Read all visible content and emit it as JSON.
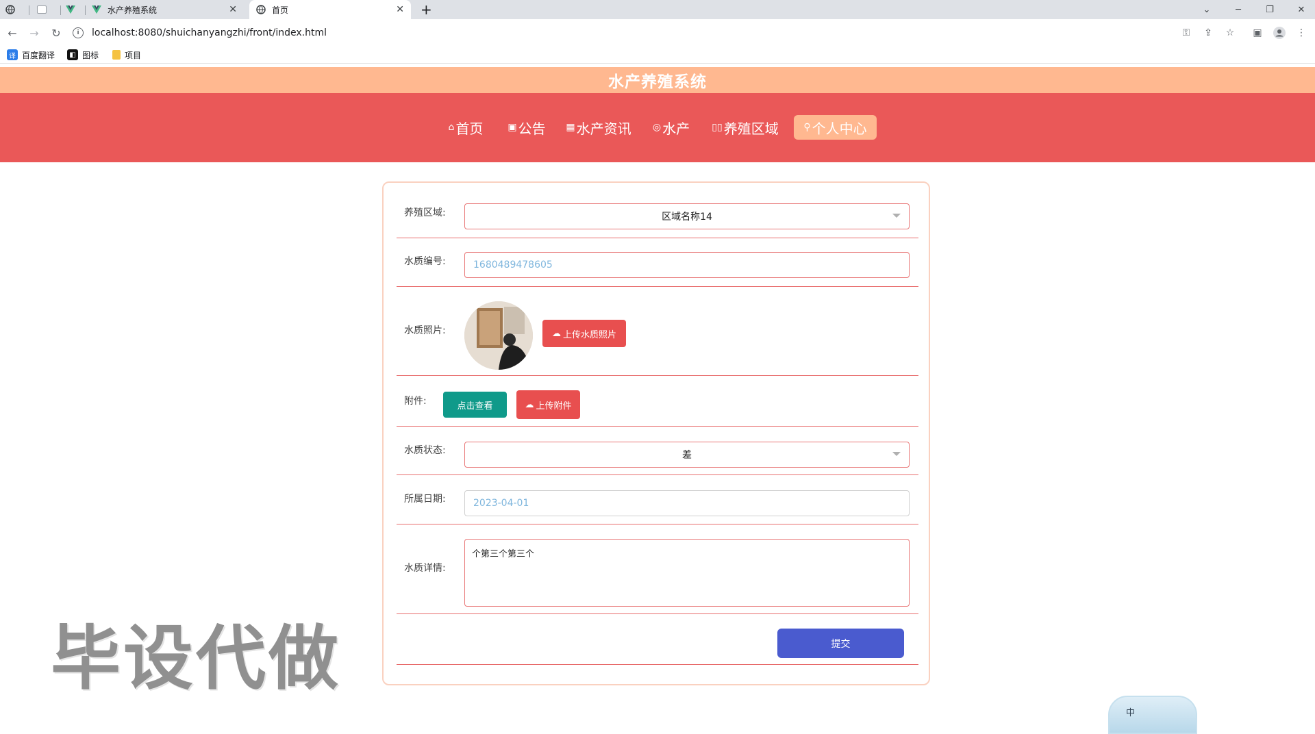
{
  "browser": {
    "tabs": [
      {
        "title": "",
        "icon": "globe-icon"
      },
      {
        "title": "",
        "icon": "blank-page-icon"
      },
      {
        "title": "",
        "icon": "vue-icon"
      },
      {
        "title": "水产养殖系统",
        "icon": "vue-icon"
      },
      {
        "title": "首页",
        "icon": "globe-icon",
        "active": true
      }
    ],
    "new_tab": "+",
    "url": "localhost:8080/shuichanyangzhi/front/index.html",
    "bookmarks": [
      {
        "label": "百度翻译",
        "icon": "translate-icon",
        "color": "#2b7de9"
      },
      {
        "label": "图标",
        "icon": "iconfont-icon",
        "color": "#111111"
      },
      {
        "label": "项目",
        "icon": "folder-icon",
        "color": "#f5c242"
      }
    ]
  },
  "site": {
    "title": "水产养殖系统",
    "nav": [
      {
        "label": "首页",
        "icon": "home-icon"
      },
      {
        "label": "公告",
        "icon": "notice-icon"
      },
      {
        "label": "水产资讯",
        "icon": "news-icon"
      },
      {
        "label": "水产",
        "icon": "fish-icon"
      },
      {
        "label": "养殖区域",
        "icon": "region-icon"
      },
      {
        "label": "个人中心",
        "icon": "user-icon",
        "active": true
      }
    ],
    "colors": {
      "header": "#ffb890",
      "nav": "#ea5858",
      "accent": "#e84f4f",
      "teal": "#0f9a8a",
      "submit": "#4a5bcf"
    }
  },
  "form": {
    "region": {
      "label": "养殖区域:",
      "value": "区域名称14"
    },
    "water_no": {
      "label": "水质编号:",
      "value": "1680489478605"
    },
    "photo": {
      "label": "水质照片:",
      "upload": "上传水质照片"
    },
    "attachment": {
      "label": "附件:",
      "view": "点击查看",
      "upload": "上传附件"
    },
    "status": {
      "label": "水质状态:",
      "value": "差"
    },
    "date": {
      "label": "所属日期:",
      "value": "2023-04-01"
    },
    "detail": {
      "label": "水质详情:",
      "value": "个第三个第三个"
    },
    "submit": "提交"
  },
  "overlay": {
    "watermark": "毕设代做",
    "ime": "中"
  }
}
